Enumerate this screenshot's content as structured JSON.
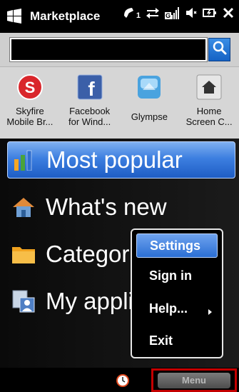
{
  "status_bar": {
    "title": "Marketplace",
    "icons": [
      "windows-logo-icon",
      "phone-call-forward-icon",
      "data-sync-icon",
      "signal-g-icon",
      "volume-mute-icon",
      "battery-charging-icon",
      "close-icon"
    ],
    "call_badge": "1",
    "signal_label": "G"
  },
  "search": {
    "value": "",
    "placeholder": ""
  },
  "featured_apps": [
    {
      "label": "Skyfire\nMobile Br...",
      "icon": "skyfire-icon"
    },
    {
      "label": "Facebook\nfor Wind...",
      "icon": "facebook-icon"
    },
    {
      "label": "Glympse",
      "icon": "glympse-icon"
    },
    {
      "label": "Home\nScreen C...",
      "icon": "home-screen-icon"
    }
  ],
  "main_list": [
    {
      "label": "Most popular",
      "icon": "bar-chart-icon",
      "selected": true
    },
    {
      "label": "What's new",
      "icon": "house-new-icon",
      "selected": false
    },
    {
      "label": "Categories",
      "icon": "folder-icon",
      "selected": false
    },
    {
      "label": "My applications",
      "icon": "user-apps-icon",
      "selected": false
    }
  ],
  "popup_menu": {
    "items": [
      {
        "label": "Settings",
        "active": true
      },
      {
        "label": "Sign in",
        "active": false
      },
      {
        "label": "Help...",
        "active": false,
        "has_submenu": true
      },
      {
        "label": "Exit",
        "active": false
      }
    ]
  },
  "softkeys": {
    "right_label": "Menu",
    "center_icon": "clock-icon"
  },
  "colors": {
    "selection_blue": "#2b6fd4",
    "highlight_red": "#c40000",
    "statusbar_bg": "#000000"
  }
}
